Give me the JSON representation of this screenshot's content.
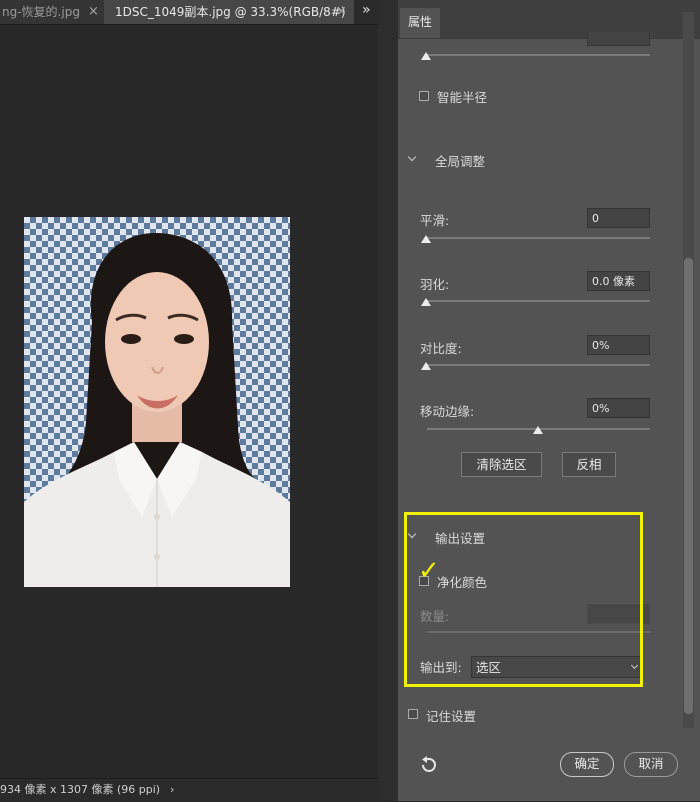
{
  "tabs": [
    {
      "label": "ng-恢复的.jpg",
      "close": "×"
    },
    {
      "label": "1DSC_1049副本.jpg @ 33.3%(RGB/8#)",
      "close": "×"
    }
  ],
  "tabbar_overflow": "»",
  "status_bar": {
    "text": "934 像素 x 1307 像素 (96 ppi)",
    "arrow": "›"
  },
  "panel": {
    "tab_label": "属性",
    "smart_radius": {
      "label": "智能半径",
      "checked": false
    },
    "global_adjust": {
      "title": "全局调整",
      "smooth": {
        "label": "平滑:",
        "value": "0"
      },
      "feather": {
        "label": "羽化:",
        "value": "0.0 像素"
      },
      "contrast": {
        "label": "对比度:",
        "value": "0%"
      },
      "shift_edge": {
        "label": "移动边缘:",
        "value": "0%"
      },
      "clear_selection": "清除选区",
      "invert": "反相"
    },
    "output": {
      "title": "输出设置",
      "decontaminate": {
        "label": "净化颜色",
        "checked": true,
        "annotation": "✓"
      },
      "amount": {
        "label": "数量:",
        "value": ""
      },
      "output_to": {
        "label": "输出到:",
        "selected": "选区"
      }
    },
    "remember": {
      "label": "记住设置",
      "checked": false
    },
    "ok": "确定",
    "cancel": "取消"
  },
  "colors": {
    "highlight": "#f2f200",
    "panel_bg": "#535353",
    "transparent_checker": "#5e7a9c"
  },
  "icons": {
    "reset": "reset-icon",
    "expand": "chevron-down-icon",
    "panel_menu": "double-chevron-icon"
  }
}
